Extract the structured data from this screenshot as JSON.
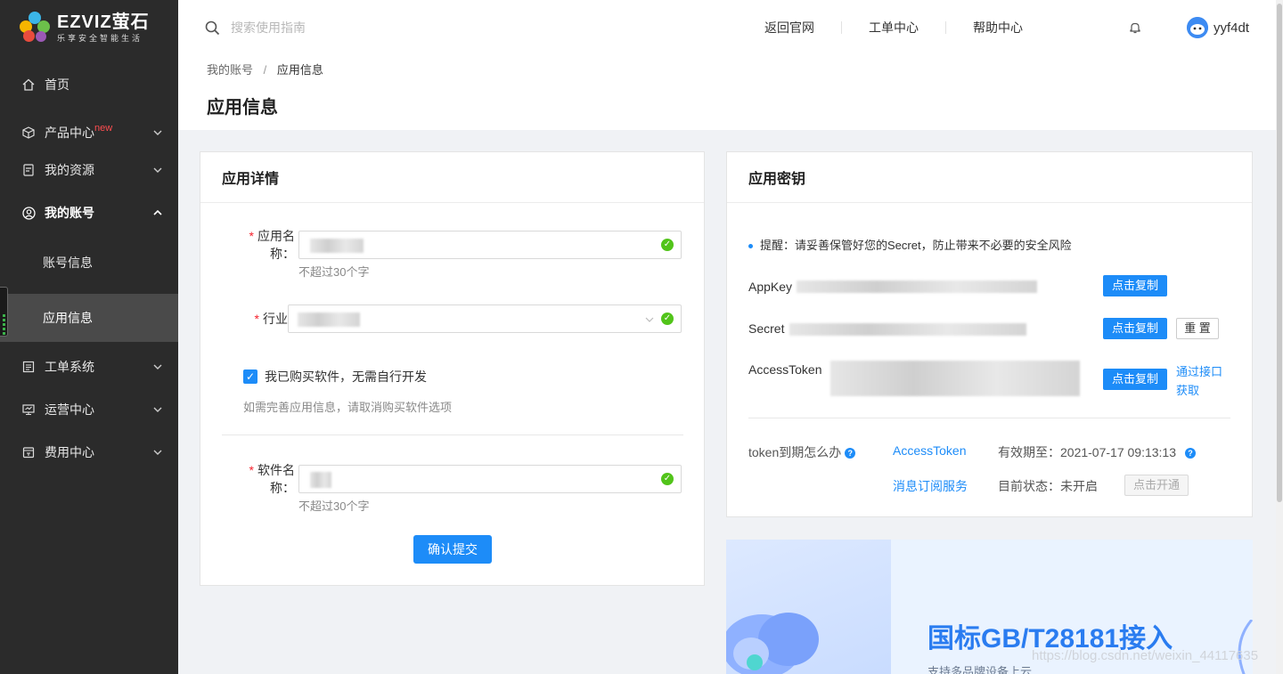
{
  "brand": {
    "name": "EZVIZ萤石",
    "slogan": "乐享安全智能生活"
  },
  "sidebar": {
    "items": [
      {
        "label": "首页",
        "icon": "home-icon"
      },
      {
        "label": "产品中心",
        "badge": "new",
        "icon": "cube-icon"
      },
      {
        "label": "我的资源",
        "icon": "document-icon"
      },
      {
        "label": "我的账号",
        "icon": "user-icon",
        "expanded": true
      },
      {
        "label": "工单系统",
        "icon": "list-icon"
      },
      {
        "label": "运营中心",
        "icon": "monitor-icon"
      },
      {
        "label": "费用中心",
        "icon": "wallet-icon"
      }
    ],
    "subitems": [
      {
        "label": "账号信息"
      },
      {
        "label": "应用信息",
        "active": true
      }
    ]
  },
  "header": {
    "search_placeholder": "搜索使用指南",
    "links": [
      "返回官网",
      "工单中心",
      "帮助中心"
    ],
    "username": "yyf4dt"
  },
  "breadcrumb": {
    "parent": "我的账号",
    "separator": "/",
    "current": "应用信息"
  },
  "page_title": "应用信息",
  "app_detail": {
    "title": "应用详情",
    "app_name_label": "应用名称：",
    "app_name_hint": "不超过30个字",
    "industry_label": "行业",
    "checkbox_label": "我已购买软件，无需自行开发",
    "checkbox_checked": true,
    "checkbox_hint": "如需完善应用信息，请取消购买软件选项",
    "software_name_label": "软件名称：",
    "software_name_hint": "不超过30个字",
    "submit_label": "确认提交"
  },
  "app_key": {
    "title": "应用密钥",
    "notice": "提醒：请妥善保管好您的Secret，防止带来不必要的安全风险",
    "appkey_label": "AppKey",
    "secret_label": "Secret",
    "token_label": "AccessToken",
    "copy_label": "点击复制",
    "reset_label": "重 置",
    "api_link_line1": "通过接口",
    "api_link_line2": "获取",
    "token_faq": "token到期怎么办",
    "token_link": "AccessToken",
    "expire_label": "有效期至：",
    "expire_value": "2021-07-17 09:13:13",
    "msg_service_link": "消息订阅服务",
    "status_label": "目前状态：",
    "status_value": "未开启",
    "open_label": "点击开通"
  },
  "banner": {
    "title": "国标GB/T28181接入",
    "subtitle": "支持多品牌设备上云"
  },
  "watermark": "https://blog.csdn.net/weixin_44117635",
  "colors": {
    "accent": "#1d8cf8",
    "sidebar_bg": "#2b2b2b",
    "success": "#52c41a",
    "required": "#f5222d"
  }
}
